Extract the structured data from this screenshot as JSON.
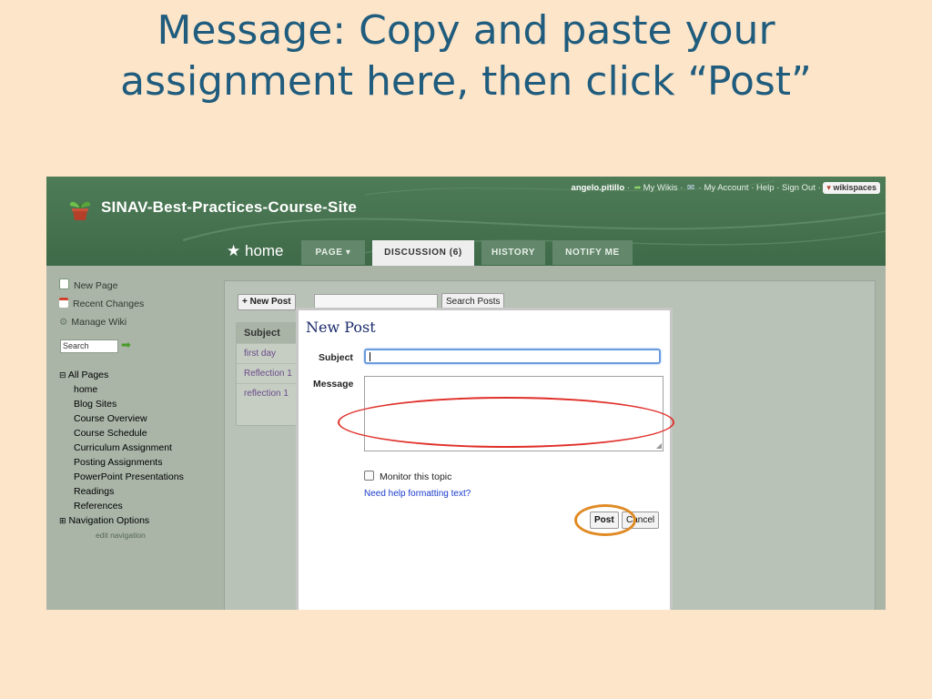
{
  "slide": {
    "title_line1": "Message: Copy and paste your",
    "title_line2": "assignment here, then click “Post”"
  },
  "site": {
    "title": "SINAV-Best-Practices-Course-Site",
    "logo_icon": "plant-pot-icon"
  },
  "userbar": {
    "username": "angelo.pitillo",
    "sep": "·",
    "my_wikis": "My Wikis",
    "my_account": "My Account",
    "help": "Help",
    "sign_out": "Sign Out",
    "badge": "wikispaces",
    "icons": [
      "arrow-icon",
      "mail-icon",
      "plant-icon"
    ]
  },
  "tabs": {
    "home": "home",
    "page": "PAGE",
    "discussion": "DISCUSSION (6)",
    "history": "HISTORY",
    "notify": "NOTIFY ME"
  },
  "sidebar": {
    "actions": [
      {
        "label": "New Page",
        "icon": "new-page-icon"
      },
      {
        "label": "Recent Changes",
        "icon": "calendar-icon"
      },
      {
        "label": "Manage Wiki",
        "icon": "gear-icon"
      }
    ],
    "search_value": "Search",
    "all_pages": "All Pages",
    "pages": [
      "home",
      "Blog Sites",
      "Course Overview",
      "Course Schedule",
      "Curriculum Assignment",
      "Posting Assignments",
      "PowerPoint Presentations",
      "Readings",
      "References"
    ],
    "nav_options": "Navigation Options",
    "edit_nav": "edit navigation"
  },
  "discussion": {
    "new_post_btn": "+ New Post",
    "search_posts_btn": "Search Posts",
    "subject_header": "Subject",
    "topics": [
      "first day",
      "Reflection 1",
      "reflection 1"
    ]
  },
  "dialog": {
    "title": "New Post",
    "subject_label": "Subject",
    "message_label": "Message",
    "subject_value": "",
    "message_value": "",
    "monitor_label": "Monitor this topic",
    "help_link": "Need help formatting text?",
    "post_btn": "Post",
    "cancel_btn": "Cancel"
  },
  "colors": {
    "slide_bg": "#fde5c9",
    "title_blue": "#1f5c7d",
    "header_green": "#4e7c57",
    "highlight_red": "#e0302a",
    "highlight_orange": "#e08a24"
  }
}
